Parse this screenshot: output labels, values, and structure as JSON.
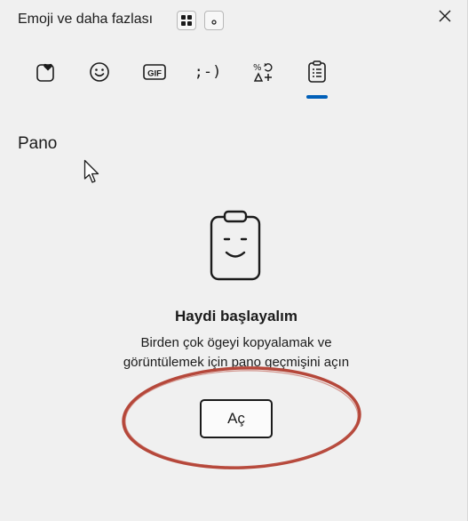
{
  "window": {
    "title": "Emoji ve daha fazlası"
  },
  "tabs": [
    {
      "name": "favorites",
      "icon": "heart-square-icon",
      "label": ""
    },
    {
      "name": "emoji",
      "icon": "smiley-icon",
      "label": ""
    },
    {
      "name": "gif",
      "icon": "gif-icon",
      "label": ""
    },
    {
      "name": "kaomoji",
      "icon": "kaomoji-icon",
      "label": ";-)"
    },
    {
      "name": "symbols",
      "icon": "symbols-icon",
      "label": ""
    },
    {
      "name": "clipboard",
      "icon": "clipboard-icon",
      "label": "",
      "selected": true
    }
  ],
  "section": {
    "title": "Pano"
  },
  "empty_state": {
    "title": "Haydi başlayalım",
    "description_line1": "Birden çok ögeyi kopyalamak ve",
    "description_line2": "görüntülemek için pano geçmişini açın",
    "button_label": "Aç"
  },
  "colors": {
    "background": "#f0f0f0",
    "accent": "#005fb8",
    "annotation": "#b5473a",
    "text": "#1b1b1b"
  }
}
